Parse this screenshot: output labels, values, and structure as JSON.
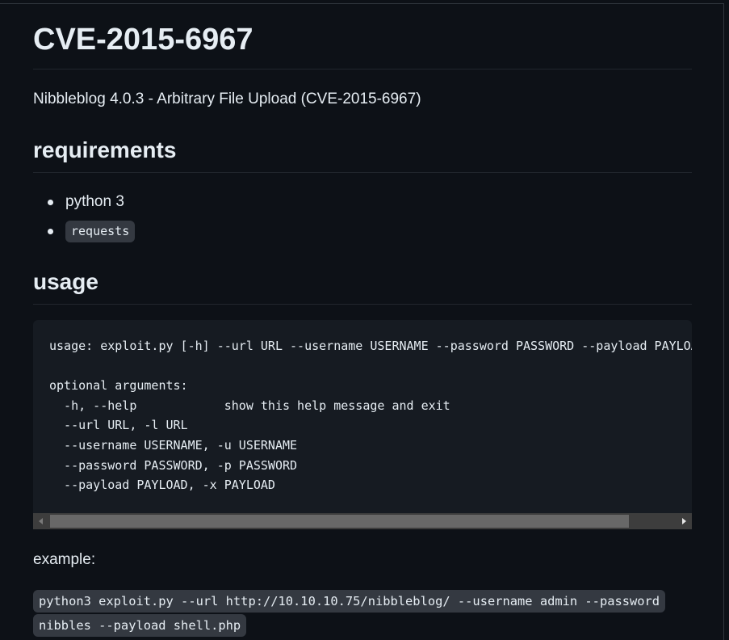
{
  "title": "CVE-2015-6967",
  "subtitle": "Nibbleblog 4.0.3 - Arbitrary File Upload (CVE-2015-6967)",
  "requirements": {
    "heading": "requirements",
    "items": [
      "python 3",
      "requests"
    ]
  },
  "usage": {
    "heading": "usage",
    "code": "usage: exploit.py [-h] --url URL --username USERNAME --password PASSWORD --payload PAYLOAD\n\noptional arguments:\n  -h, --help            show this help message and exit\n  --url URL, -l URL\n  --username USERNAME, -u USERNAME\n  --password PASSWORD, -p PASSWORD\n  --payload PAYLOAD, -x PAYLOAD"
  },
  "example": {
    "label": "example:",
    "code": "python3 exploit.py --url http://10.10.10.75/nibbleblog/ --username admin --password nibbles --payload shell.php"
  },
  "colors": {
    "background": "#0d1117",
    "text": "#e6edf3",
    "code_background": "#161b22",
    "inline_code_background": "#343941",
    "divider": "#21262d"
  }
}
